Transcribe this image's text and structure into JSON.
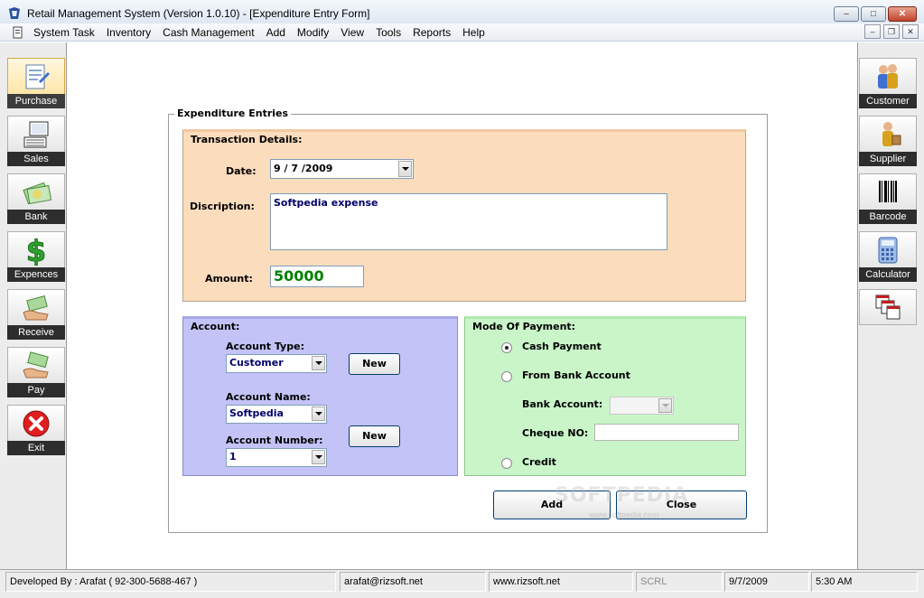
{
  "window": {
    "title": "Retail Management System (Version 1.0.10) - [Expenditure Entry Form]",
    "minimize": "‒",
    "maximize": "□",
    "close": "✕"
  },
  "menu": {
    "items": [
      "System Task",
      "Inventory",
      "Cash Management",
      "Add",
      "Modify",
      "View",
      "Tools",
      "Reports",
      "Help"
    ],
    "mdi_minimize": "‒",
    "mdi_restore": "❐",
    "mdi_close": "✕"
  },
  "left_toolbar": [
    {
      "label": "Purchase",
      "icon": "purchase-icon"
    },
    {
      "label": "Sales",
      "icon": "sales-icon"
    },
    {
      "label": "Bank",
      "icon": "bank-icon"
    },
    {
      "label": "Expences",
      "icon": "expenses-icon"
    },
    {
      "label": "Receive",
      "icon": "receive-icon"
    },
    {
      "label": "Pay",
      "icon": "pay-icon"
    },
    {
      "label": "Exit",
      "icon": "exit-icon"
    }
  ],
  "right_toolbar": [
    {
      "label": "Customer",
      "icon": "customer-icon"
    },
    {
      "label": "Supplier",
      "icon": "supplier-icon"
    },
    {
      "label": "Barcode",
      "icon": "barcode-icon"
    },
    {
      "label": "Calculator",
      "icon": "calculator-icon"
    },
    {
      "label": "",
      "icon": "cascade-windows-icon"
    }
  ],
  "form": {
    "group_title": "Expenditure Entries",
    "transaction": {
      "title": "Transaction Details:",
      "date_label": "Date:",
      "date_value": "9 / 7 /2009",
      "description_label": "Discription:",
      "description_value": "Softpedia expense",
      "amount_label": "Amount:",
      "amount_value": "50000"
    },
    "account": {
      "title": "Account:",
      "type_label": "Account Type:",
      "type_value": "Customer",
      "name_label": "Account Name:",
      "name_value": "Softpedia",
      "number_label": "Account Number:",
      "number_value": "1",
      "new_type_button": "New",
      "new_number_button": "New"
    },
    "payment": {
      "title": "Mode Of Payment:",
      "cash_label": "Cash Payment",
      "bank_label": "From Bank Account",
      "bank_account_label": "Bank Account:",
      "bank_account_value": "",
      "cheque_label": "Cheque NO:",
      "cheque_value": "",
      "credit_label": "Credit",
      "selected": "cash"
    },
    "add_button": "Add",
    "close_button": "Close"
  },
  "watermark": {
    "text": "SOFTPEDIA",
    "sub": "www.softpedia.com"
  },
  "status": {
    "developer": "Developed By : Arafat ( 92-300-5688-467 )",
    "email": "arafat@rizsoft.net",
    "website": "www.rizsoft.net",
    "scroll": "SCRL",
    "date": "9/7/2009",
    "time": "5:30 AM"
  },
  "colors": {
    "transaction_panel": "#fbdcbd",
    "account_panel": "#c3c3f7",
    "payment_panel": "#c9f5c9",
    "amount_text": "#008000",
    "field_text": "#00006b"
  }
}
